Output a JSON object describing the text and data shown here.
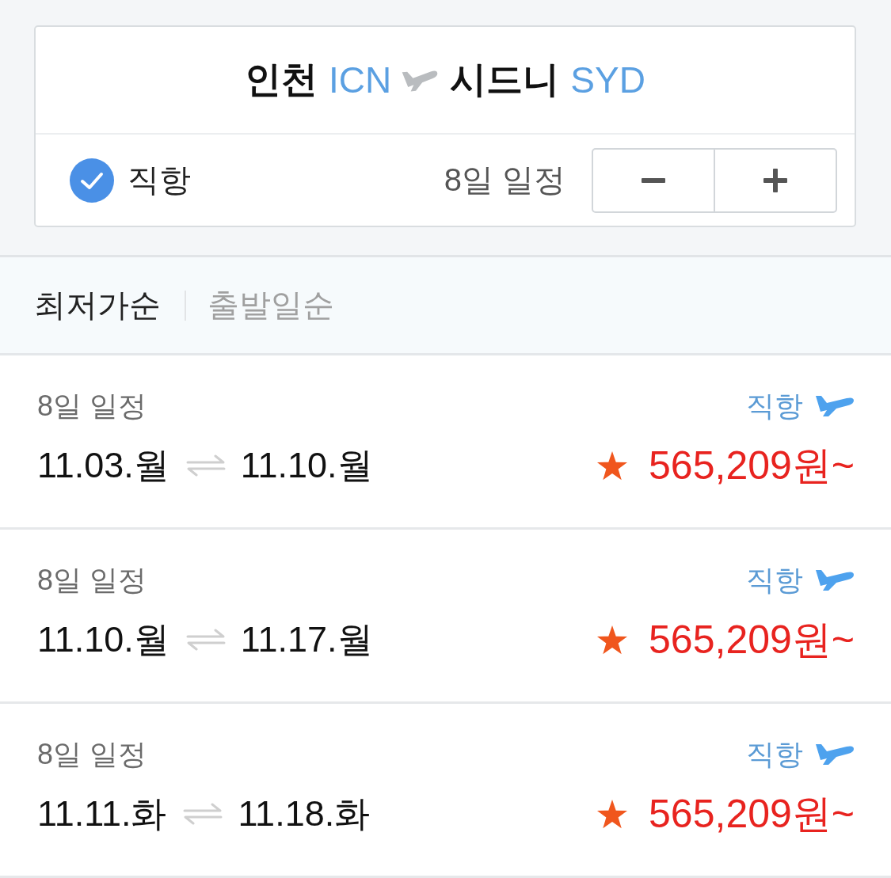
{
  "route": {
    "origin": {
      "city": "인천",
      "code": "ICN"
    },
    "destination": {
      "city": "시드니",
      "code": "SYD"
    }
  },
  "filters": {
    "direct": {
      "label": "직항",
      "checked": true
    },
    "duration": "8일 일정"
  },
  "sort_tabs": [
    {
      "label": "최저가순",
      "selected": true
    },
    {
      "label": "출발일순",
      "selected": false
    }
  ],
  "trips": [
    {
      "duration": "8일 일정",
      "tag": "직항",
      "depart": "11.03.월",
      "return": "11.10.월",
      "starred": true,
      "price": "565,209원~"
    },
    {
      "duration": "8일 일정",
      "tag": "직항",
      "depart": "11.10.월",
      "return": "11.17.월",
      "starred": true,
      "price": "565,209원~"
    },
    {
      "duration": "8일 일정",
      "tag": "직항",
      "depart": "11.11.화",
      "return": "11.18.화",
      "starred": true,
      "price": "565,209원~"
    }
  ]
}
